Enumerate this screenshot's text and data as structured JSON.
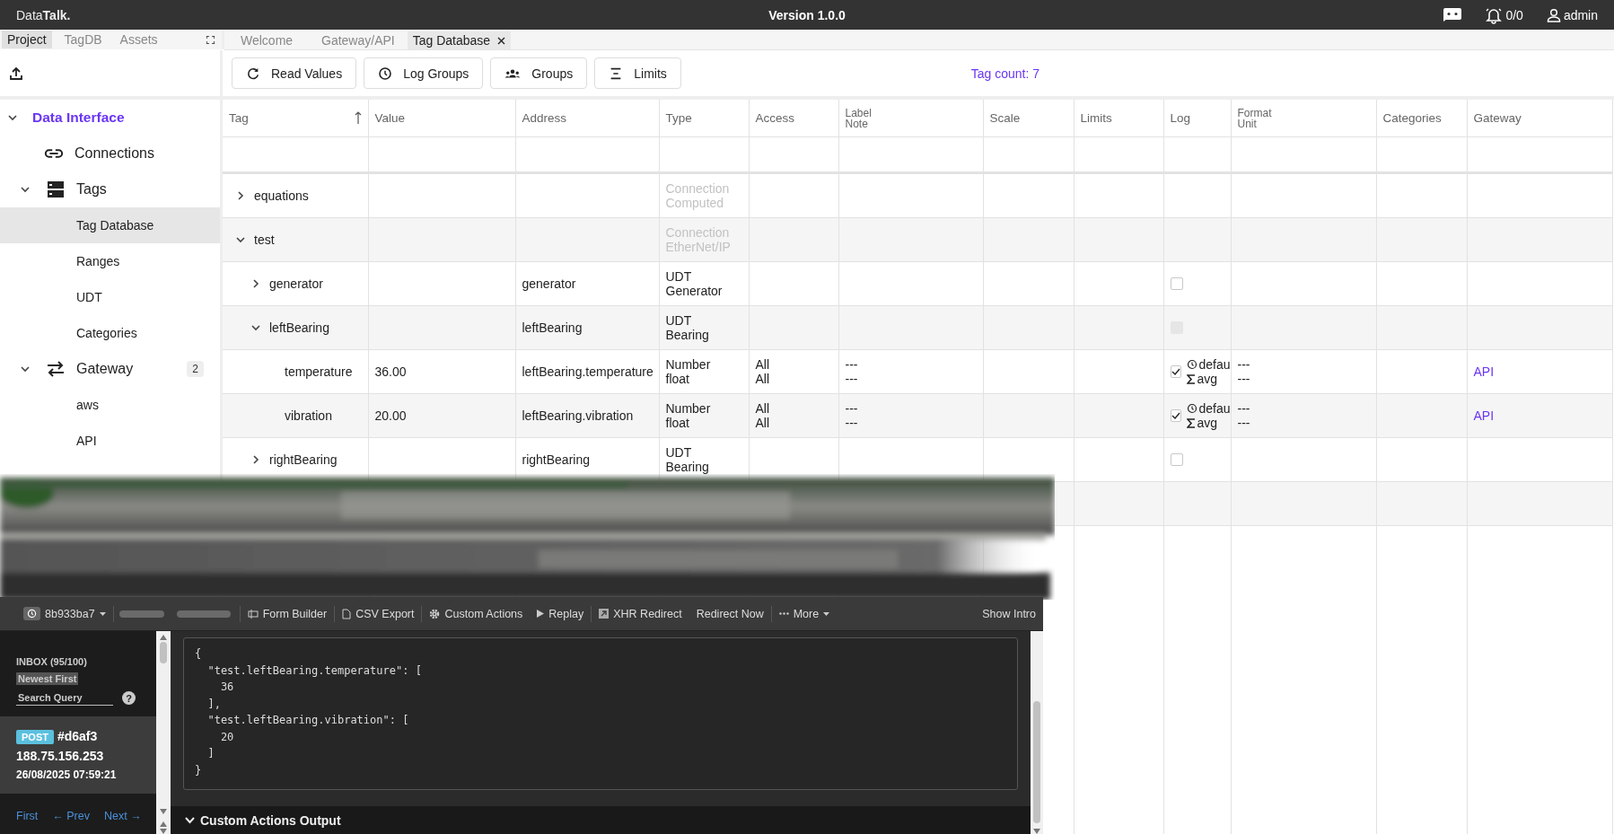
{
  "app_bar": {
    "logo": "Data**Talk.**",
    "version": "Version 1.0.0",
    "alerts": "0/0",
    "user": "admin"
  },
  "panel_tabs": [
    {
      "label": "Project",
      "selected": true
    },
    {
      "label": "TagDB",
      "selected": false
    },
    {
      "label": "Assets",
      "selected": false
    }
  ],
  "doc_tabs": [
    {
      "label": "Welcome",
      "selected": false
    },
    {
      "label": "Gateway/API",
      "selected": false
    },
    {
      "label": "Tag Database",
      "selected": true
    }
  ],
  "toolbar": {
    "buttons": [
      {
        "label": "Read Values",
        "kind": "refresh"
      },
      {
        "label": "Log Groups",
        "kind": "clock"
      },
      {
        "label": "Groups",
        "kind": "groups"
      },
      {
        "label": "Limits",
        "kind": "limits"
      }
    ],
    "tag_count": "Tag count: 7"
  },
  "sidebar": {
    "items": [
      {
        "label": "Data Interface",
        "kind": "section",
        "expanded": true,
        "selected": false,
        "children": [
          {
            "label": "Connections",
            "kind": "link",
            "selected": false
          },
          {
            "label": "Tags",
            "kind": "storage",
            "expanded": true,
            "selected": false,
            "children": [
              {
                "label": "Tag Database",
                "selected": true
              },
              {
                "label": "Ranges",
                "selected": false
              },
              {
                "label": "UDT",
                "selected": false
              },
              {
                "label": "Categories",
                "selected": false
              }
            ]
          },
          {
            "label": "Gateway",
            "kind": "swap",
            "expanded": true,
            "selected": false,
            "badge": "2",
            "children": [
              {
                "label": "aws",
                "selected": false
              },
              {
                "label": "API",
                "selected": false
              }
            ]
          }
        ]
      }
    ]
  },
  "table": {
    "columns": [
      {
        "label": "Tag",
        "sorted": true
      },
      {
        "label": "Value",
        "sorted": false
      },
      {
        "label": "Address",
        "sorted": false
      },
      {
        "label": "Type",
        "sorted": false
      },
      {
        "label": "Access",
        "sorted": false
      },
      {
        "label": "Label",
        "sublabel": "Note",
        "sorted": false
      },
      {
        "label": "Scale",
        "sorted": false
      },
      {
        "label": "Limits",
        "sorted": false
      },
      {
        "label": "Log",
        "sorted": false
      },
      {
        "label": "Format",
        "sublabel": "Unit",
        "sorted": false
      },
      {
        "label": "Categories",
        "sorted": false
      },
      {
        "label": "Gateway",
        "sorted": false
      }
    ],
    "rows": [
      {
        "tag": "equations",
        "kind": "connection",
        "expanded": false,
        "type": [
          "Connection",
          "Computed"
        ]
      },
      {
        "tag": "test",
        "kind": "connection",
        "expanded": true,
        "type": [
          "Connection",
          "EtherNet/IP"
        ],
        "children": [
          {
            "tag": "generator",
            "kind": "udt",
            "expanded": false,
            "address": "generator",
            "type": [
              "UDT",
              "Generator"
            ],
            "log": {
              "checked": false,
              "disabled": false
            }
          },
          {
            "tag": "leftBearing",
            "kind": "udt",
            "expanded": true,
            "address": "leftBearing",
            "type": [
              "UDT",
              "Bearing"
            ],
            "log": {
              "checked": false,
              "disabled": true
            },
            "children": [
              {
                "tag": "temperature",
                "kind": "tag",
                "value": "36.00",
                "address": "leftBearing.temperature",
                "type": [
                  "Number",
                  "float"
                ],
                "access": [
                  "All",
                  "All"
                ],
                "label": [
                  "---",
                  "---"
                ],
                "log": {
                  "checked": true,
                  "disabled": false,
                  "group": "defau",
                  "aggregate": "avg"
                },
                "format": [
                  "---",
                  "---"
                ],
                "gateway": "API"
              },
              {
                "tag": "vibration",
                "kind": "tag",
                "value": "20.00",
                "address": "leftBearing.vibration",
                "type": [
                  "Number",
                  "float"
                ],
                "access": [
                  "All",
                  "All"
                ],
                "label": [
                  "---",
                  "---"
                ],
                "log": {
                  "checked": true,
                  "disabled": false,
                  "group": "defau",
                  "aggregate": "avg"
                },
                "format": [
                  "---",
                  "---"
                ],
                "gateway": "API"
              }
            ]
          },
          {
            "tag": "rightBearing",
            "kind": "udt",
            "expanded": false,
            "address": "rightBearing",
            "type": [
              "UDT",
              "Bearing"
            ],
            "log": {
              "checked": false,
              "disabled": false
            }
          }
        ]
      }
    ]
  },
  "inspector": {
    "toolbar": [
      {
        "label": "8b933ba7",
        "kind": "session",
        "divider_after": true
      },
      {
        "label": "Form Builder",
        "kind": "form",
        "divider_after": true
      },
      {
        "label": "CSV Export",
        "kind": "csv",
        "divider_after": true
      },
      {
        "label": "Custom Actions",
        "kind": "gear",
        "divider_after": false
      },
      {
        "label": "Replay",
        "kind": "play",
        "divider_after": true
      },
      {
        "label": "XHR Redirect",
        "kind": "redirect",
        "divider_after": false
      },
      {
        "label": "Redirect Now",
        "kind": "plain",
        "divider_after": true
      },
      {
        "label": "More",
        "kind": "more",
        "divider_after": false
      }
    ],
    "show_intro": "Show Intro",
    "inbox": {
      "title": "INBOX (95/100)",
      "sort": "Newest First",
      "search_placeholder": "Search Query",
      "help": "?"
    },
    "request": {
      "method": "POST",
      "id": "#d6af3",
      "ip": "188.75.156.253",
      "time": "26/08/2025 07:59:21",
      "selected": true
    },
    "pager": [
      "First",
      "← Prev",
      "Next →"
    ],
    "body_lines": [
      "{",
      "  \"test.leftBearing.temperature\": [",
      "    36",
      "  ],",
      "  \"test.leftBearing.vibration\": [",
      "    20",
      "  ]",
      "}"
    ],
    "output_title": "Custom Actions Output"
  }
}
